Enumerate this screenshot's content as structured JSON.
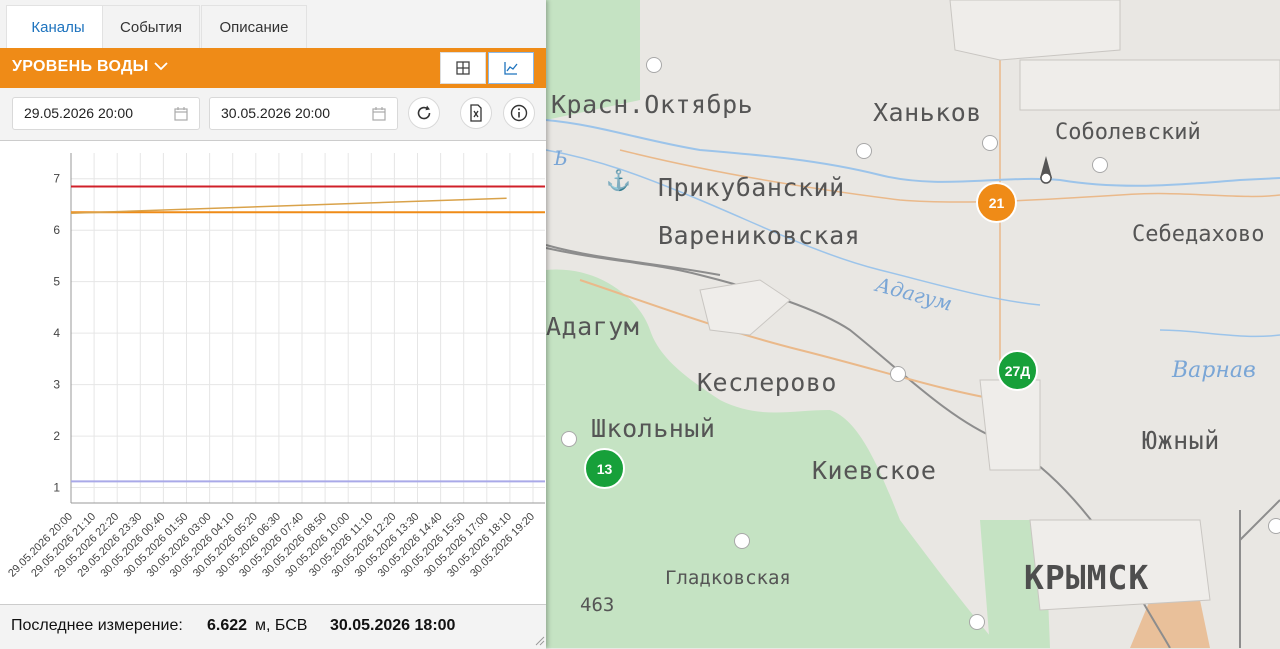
{
  "tabs": [
    {
      "label": "Каналы"
    },
    {
      "label": "События"
    },
    {
      "label": "Описание"
    }
  ],
  "channel": {
    "name": "УРОВЕНЬ ВОДЫ",
    "icons": {
      "dropdown": "chevron-down-icon",
      "table_view": "table-icon",
      "chart_view": "line-chart-icon"
    }
  },
  "filters": {
    "date_from": "29.05.2026 20:00",
    "date_to": "30.05.2026 20:00",
    "icons": [
      "calendar-icon",
      "refresh-icon",
      "excel-export-icon",
      "info-icon"
    ]
  },
  "chart_data": {
    "type": "line",
    "yticks": [
      "1",
      "2",
      "3",
      "4",
      "5",
      "6",
      "7"
    ],
    "ylim": [
      0.7,
      7.5
    ],
    "x": [
      "29.05.2026 20:00",
      "29.05.2026 21:10",
      "29.05.2026 22:20",
      "29.05.2026 23:30",
      "30.05.2026 00:40",
      "30.05.2026 01:50",
      "30.05.2026 03:00",
      "30.05.2026 04:10",
      "30.05.2026 05:20",
      "30.05.2026 06:30",
      "30.05.2026 07:40",
      "30.05.2026 08:50",
      "30.05.2026 10:00",
      "30.05.2026 11:10",
      "30.05.2026 12:20",
      "30.05.2026 13:30",
      "30.05.2026 14:40",
      "30.05.2026 15:50",
      "30.05.2026 17:00",
      "30.05.2026 18:10",
      "30.05.2026 19:20"
    ],
    "grid": true,
    "thresholds": [
      {
        "value": 6.85,
        "color": "#d0202a"
      },
      {
        "value": 6.35,
        "color": "#ef8b17"
      },
      {
        "value": 1.12,
        "color": "#a9a9e8"
      }
    ],
    "series": [
      {
        "color": "#d9a24a",
        "start": "29.05.2026 20:00",
        "end": "30.05.2026 18:00",
        "values": [
          6.33,
          6.622
        ]
      }
    ]
  },
  "footer": {
    "label": "Последнее измерение:",
    "value": "6.622",
    "unit": "м, БСВ",
    "timestamp": "30.05.2026 18:00"
  },
  "map": {
    "towns": [
      "Красн.Октябрь",
      "Ханьков",
      "Соболевский",
      "Прикубанский",
      "Варениковская",
      "Себедахово",
      "Адагум",
      "Кеслерово",
      "Школьный",
      "Южный",
      "Киевское",
      "Гладковская",
      "КРЫМСК",
      "463"
    ],
    "rivers": [
      "Адагум",
      "Варнав",
      "Ь"
    ],
    "markers": [
      {
        "label": "21",
        "color": "#ef8b17"
      },
      {
        "label": "27Д",
        "color": "#17a03a"
      },
      {
        "label": "13",
        "color": "#17a03a"
      }
    ]
  }
}
